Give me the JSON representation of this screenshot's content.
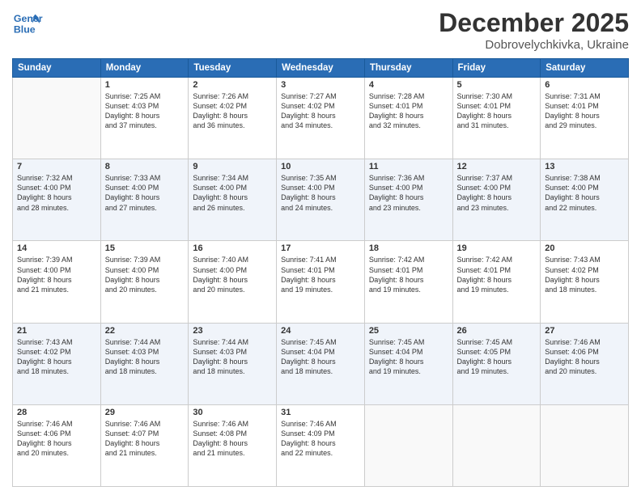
{
  "header": {
    "logo_line1": "General",
    "logo_line2": "Blue",
    "month": "December 2025",
    "location": "Dobrovelychkivka, Ukraine"
  },
  "days_of_week": [
    "Sunday",
    "Monday",
    "Tuesday",
    "Wednesday",
    "Thursday",
    "Friday",
    "Saturday"
  ],
  "weeks": [
    [
      {
        "day": "",
        "content": ""
      },
      {
        "day": "1",
        "content": "Sunrise: 7:25 AM\nSunset: 4:03 PM\nDaylight: 8 hours\nand 37 minutes."
      },
      {
        "day": "2",
        "content": "Sunrise: 7:26 AM\nSunset: 4:02 PM\nDaylight: 8 hours\nand 36 minutes."
      },
      {
        "day": "3",
        "content": "Sunrise: 7:27 AM\nSunset: 4:02 PM\nDaylight: 8 hours\nand 34 minutes."
      },
      {
        "day": "4",
        "content": "Sunrise: 7:28 AM\nSunset: 4:01 PM\nDaylight: 8 hours\nand 32 minutes."
      },
      {
        "day": "5",
        "content": "Sunrise: 7:30 AM\nSunset: 4:01 PM\nDaylight: 8 hours\nand 31 minutes."
      },
      {
        "day": "6",
        "content": "Sunrise: 7:31 AM\nSunset: 4:01 PM\nDaylight: 8 hours\nand 29 minutes."
      }
    ],
    [
      {
        "day": "7",
        "content": "Sunrise: 7:32 AM\nSunset: 4:00 PM\nDaylight: 8 hours\nand 28 minutes."
      },
      {
        "day": "8",
        "content": "Sunrise: 7:33 AM\nSunset: 4:00 PM\nDaylight: 8 hours\nand 27 minutes."
      },
      {
        "day": "9",
        "content": "Sunrise: 7:34 AM\nSunset: 4:00 PM\nDaylight: 8 hours\nand 26 minutes."
      },
      {
        "day": "10",
        "content": "Sunrise: 7:35 AM\nSunset: 4:00 PM\nDaylight: 8 hours\nand 24 minutes."
      },
      {
        "day": "11",
        "content": "Sunrise: 7:36 AM\nSunset: 4:00 PM\nDaylight: 8 hours\nand 23 minutes."
      },
      {
        "day": "12",
        "content": "Sunrise: 7:37 AM\nSunset: 4:00 PM\nDaylight: 8 hours\nand 23 minutes."
      },
      {
        "day": "13",
        "content": "Sunrise: 7:38 AM\nSunset: 4:00 PM\nDaylight: 8 hours\nand 22 minutes."
      }
    ],
    [
      {
        "day": "14",
        "content": "Sunrise: 7:39 AM\nSunset: 4:00 PM\nDaylight: 8 hours\nand 21 minutes."
      },
      {
        "day": "15",
        "content": "Sunrise: 7:39 AM\nSunset: 4:00 PM\nDaylight: 8 hours\nand 20 minutes."
      },
      {
        "day": "16",
        "content": "Sunrise: 7:40 AM\nSunset: 4:00 PM\nDaylight: 8 hours\nand 20 minutes."
      },
      {
        "day": "17",
        "content": "Sunrise: 7:41 AM\nSunset: 4:01 PM\nDaylight: 8 hours\nand 19 minutes."
      },
      {
        "day": "18",
        "content": "Sunrise: 7:42 AM\nSunset: 4:01 PM\nDaylight: 8 hours\nand 19 minutes."
      },
      {
        "day": "19",
        "content": "Sunrise: 7:42 AM\nSunset: 4:01 PM\nDaylight: 8 hours\nand 19 minutes."
      },
      {
        "day": "20",
        "content": "Sunrise: 7:43 AM\nSunset: 4:02 PM\nDaylight: 8 hours\nand 18 minutes."
      }
    ],
    [
      {
        "day": "21",
        "content": "Sunrise: 7:43 AM\nSunset: 4:02 PM\nDaylight: 8 hours\nand 18 minutes."
      },
      {
        "day": "22",
        "content": "Sunrise: 7:44 AM\nSunset: 4:03 PM\nDaylight: 8 hours\nand 18 minutes."
      },
      {
        "day": "23",
        "content": "Sunrise: 7:44 AM\nSunset: 4:03 PM\nDaylight: 8 hours\nand 18 minutes."
      },
      {
        "day": "24",
        "content": "Sunrise: 7:45 AM\nSunset: 4:04 PM\nDaylight: 8 hours\nand 18 minutes."
      },
      {
        "day": "25",
        "content": "Sunrise: 7:45 AM\nSunset: 4:04 PM\nDaylight: 8 hours\nand 19 minutes."
      },
      {
        "day": "26",
        "content": "Sunrise: 7:45 AM\nSunset: 4:05 PM\nDaylight: 8 hours\nand 19 minutes."
      },
      {
        "day": "27",
        "content": "Sunrise: 7:46 AM\nSunset: 4:06 PM\nDaylight: 8 hours\nand 20 minutes."
      }
    ],
    [
      {
        "day": "28",
        "content": "Sunrise: 7:46 AM\nSunset: 4:06 PM\nDaylight: 8 hours\nand 20 minutes."
      },
      {
        "day": "29",
        "content": "Sunrise: 7:46 AM\nSunset: 4:07 PM\nDaylight: 8 hours\nand 21 minutes."
      },
      {
        "day": "30",
        "content": "Sunrise: 7:46 AM\nSunset: 4:08 PM\nDaylight: 8 hours\nand 21 minutes."
      },
      {
        "day": "31",
        "content": "Sunrise: 7:46 AM\nSunset: 4:09 PM\nDaylight: 8 hours\nand 22 minutes."
      },
      {
        "day": "",
        "content": ""
      },
      {
        "day": "",
        "content": ""
      },
      {
        "day": "",
        "content": ""
      }
    ]
  ]
}
